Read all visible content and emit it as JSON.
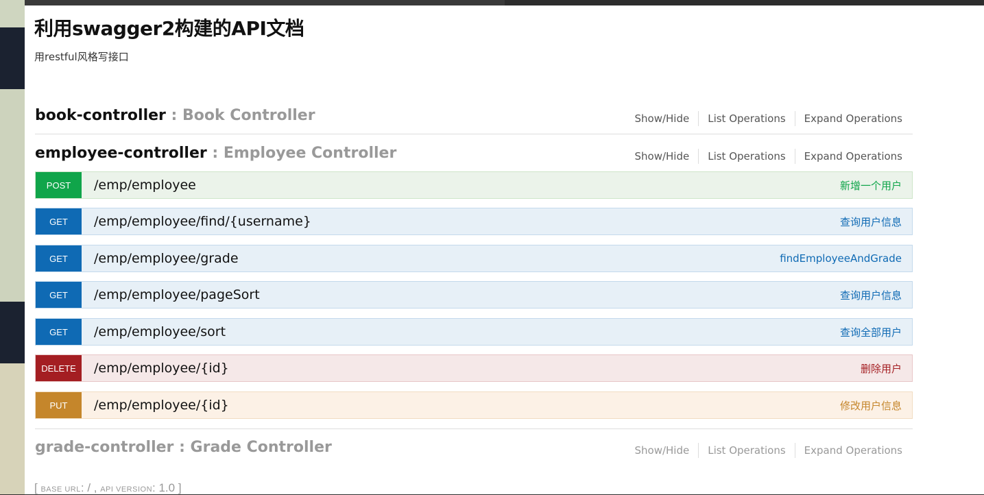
{
  "title": "利用swagger2构建的API文档",
  "subtitle": "用restful风格写接口",
  "colors": {
    "post": "#10a54a",
    "get": "#0f6ab4",
    "delete": "#a41e22",
    "put": "#c5862b"
  },
  "resources": [
    {
      "name": "book-controller",
      "separator": " : ",
      "description": "Book Controller",
      "options": [
        "Show/Hide",
        "List Operations",
        "Expand Operations"
      ]
    },
    {
      "name": "employee-controller",
      "separator": " : ",
      "description": "Employee Controller",
      "options": [
        "Show/Hide",
        "List Operations",
        "Expand Operations"
      ],
      "operations": [
        {
          "method": "POST",
          "path": "/emp/employee",
          "summary": "新增一个用户"
        },
        {
          "method": "GET",
          "path": "/emp/employee/find/{username}",
          "summary": "查询用户信息"
        },
        {
          "method": "GET",
          "path": "/emp/employee/grade",
          "summary": "findEmployeeAndGrade"
        },
        {
          "method": "GET",
          "path": "/emp/employee/pageSort",
          "summary": "查询用户信息"
        },
        {
          "method": "GET",
          "path": "/emp/employee/sort",
          "summary": "查询全部用户"
        },
        {
          "method": "DELETE",
          "path": "/emp/employee/{id}",
          "summary": "删除用户"
        },
        {
          "method": "PUT",
          "path": "/emp/employee/{id}",
          "summary": "修改用户信息"
        }
      ]
    },
    {
      "name": "grade-controller",
      "separator": " : ",
      "description": "Grade Controller",
      "options": [
        "Show/Hide",
        "List Operations",
        "Expand Operations"
      ]
    }
  ],
  "footer": {
    "open": "[ ",
    "base_url_label": "BASE URL",
    "base_url_value": ": / , ",
    "api_version_label": "API VERSION",
    "api_version_value": ": 1.0 ]"
  }
}
